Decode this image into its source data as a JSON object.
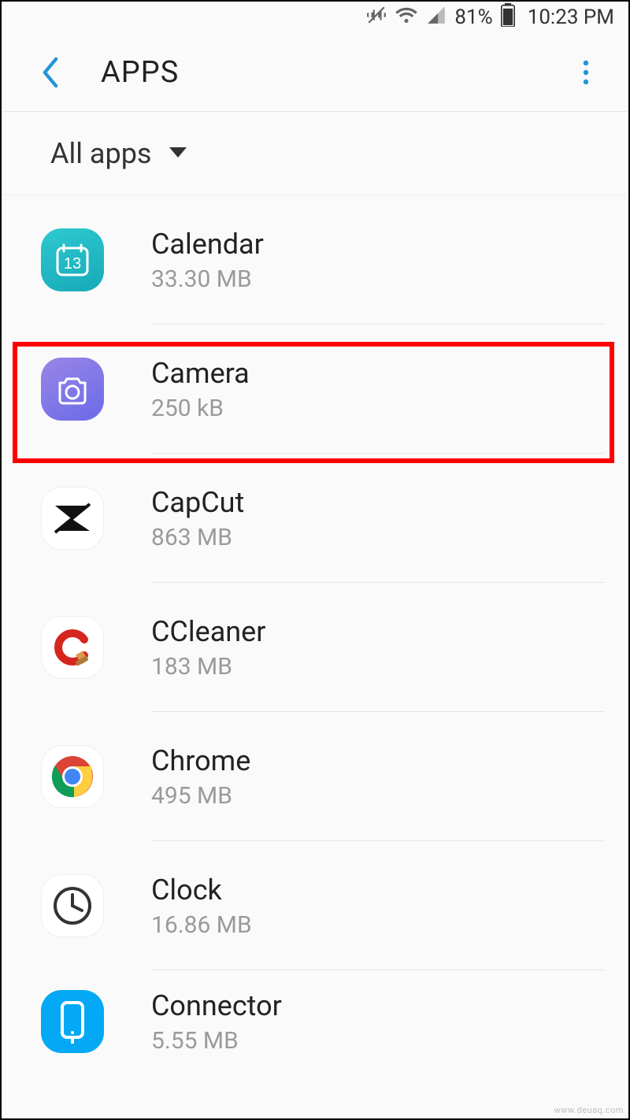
{
  "status": {
    "battery": "81%",
    "time": "10:23 PM"
  },
  "header": {
    "title": "APPS"
  },
  "filter": {
    "label": "All apps"
  },
  "apps": [
    {
      "name": "Calendar",
      "size": "33.30 MB",
      "icon": "calendar",
      "highlight": false,
      "day": "13"
    },
    {
      "name": "Camera",
      "size": "250 kB",
      "icon": "camera",
      "highlight": true
    },
    {
      "name": "CapCut",
      "size": "863 MB",
      "icon": "capcut",
      "highlight": false
    },
    {
      "name": "CCleaner",
      "size": "183 MB",
      "icon": "ccleaner",
      "highlight": false
    },
    {
      "name": "Chrome",
      "size": "495 MB",
      "icon": "chrome",
      "highlight": false
    },
    {
      "name": "Clock",
      "size": "16.86 MB",
      "icon": "clock",
      "highlight": false
    },
    {
      "name": "Connector",
      "size": "5.55 MB",
      "icon": "connector",
      "highlight": false
    }
  ],
  "watermark": "www.deuaq.com"
}
